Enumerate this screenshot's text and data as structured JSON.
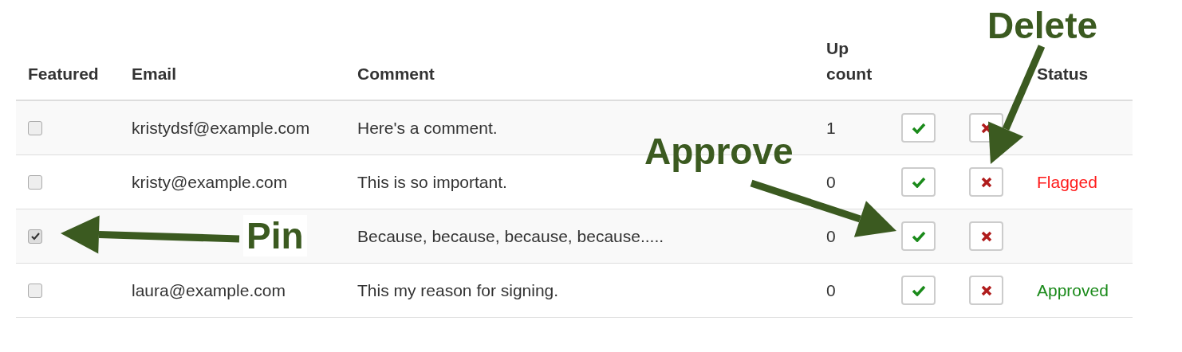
{
  "table": {
    "columns": [
      "Featured",
      "Email",
      "Comment",
      "Up count",
      "Status"
    ],
    "rows": [
      {
        "featured": false,
        "email": "kristydsf@example.com",
        "comment": "Here's a comment.",
        "up_count": "1"
      },
      {
        "featured": false,
        "email": "kristy@example.com",
        "comment": "This is so important.",
        "up_count": "0",
        "status": {
          "label": "Flagged",
          "kind": "flagged"
        }
      },
      {
        "featured": true,
        "comment": "Because, because, because, because.....",
        "up_count": "0"
      },
      {
        "featured": false,
        "email": "laura@example.com",
        "comment": "This my reason for signing.",
        "up_count": "0",
        "status": {
          "label": "Approved",
          "kind": "approved"
        }
      }
    ]
  },
  "annotations": [
    {
      "label": "Delete"
    },
    {
      "label": "Approve"
    },
    {
      "label": "Pin"
    }
  ]
}
